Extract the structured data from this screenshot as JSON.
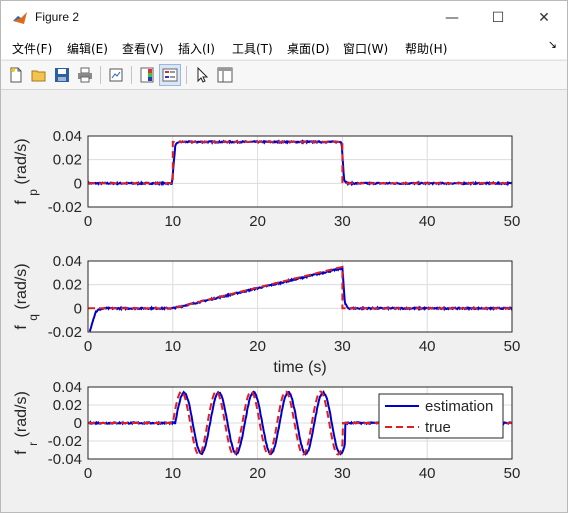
{
  "window": {
    "title": "Figure 2",
    "minimize_glyph": "—",
    "maximize_glyph": "☐",
    "close_glyph": "✕"
  },
  "menu": {
    "items": [
      "文件(F)",
      "编辑(E)",
      "查看(V)",
      "插入(I)",
      "工具(T)",
      "桌面(D)",
      "窗口(W)",
      "帮助(H)"
    ],
    "overflow_glyph": "↘"
  },
  "toolbar": {
    "icons": [
      "new-figure-icon",
      "open-file-icon",
      "save-icon",
      "print-icon",
      "link-plot-icon",
      "insert-colorbar-icon",
      "insert-legend-icon",
      "edit-plot-icon",
      "property-inspector-icon"
    ]
  },
  "colors": {
    "estimation": "#0000cc",
    "true": "#e02020",
    "axes_bg": "#ffffff",
    "grid": "#dcdcdc"
  },
  "chart_data": [
    {
      "type": "line",
      "ylabel_main": "f",
      "ylabel_sub": "p",
      "ylabel_unit": "(rad/s)",
      "xlabel": "",
      "xlim": [
        0,
        50
      ],
      "ylim": [
        -0.02,
        0.04
      ],
      "xticks": [
        "0",
        "10",
        "20",
        "30",
        "40",
        "50"
      ],
      "yticks": [
        "0.04",
        "0.02",
        "0",
        "-0.02"
      ],
      "grid": true,
      "series": [
        {
          "name": "estimation",
          "style": "solid",
          "x": [
            0,
            9.9,
            10.3,
            10.7,
            29.9,
            30.2,
            30.6,
            50
          ],
          "y": [
            0,
            0,
            0.032,
            0.035,
            0.035,
            0.003,
            0,
            0
          ]
        },
        {
          "name": "true",
          "style": "dashed",
          "x": [
            0,
            10,
            10,
            30,
            30,
            50
          ],
          "y": [
            0,
            0,
            0.035,
            0.035,
            0,
            0
          ]
        }
      ]
    },
    {
      "type": "line",
      "ylabel_main": "f",
      "ylabel_sub": "q",
      "ylabel_unit": "(rad/s)",
      "xlabel": "time (s)",
      "xlim": [
        0,
        50
      ],
      "ylim": [
        -0.02,
        0.04
      ],
      "xticks": [
        "0",
        "10",
        "20",
        "30",
        "40",
        "50"
      ],
      "yticks": [
        "0.04",
        "0.02",
        "0",
        "-0.02"
      ],
      "grid": true,
      "series": [
        {
          "name": "estimation",
          "style": "solid",
          "x": [
            0.2,
            0.5,
            0.9,
            1.3,
            2,
            10,
            30,
            30.3,
            30.7,
            50
          ],
          "y": [
            -0.02,
            -0.012,
            -0.003,
            -0.001,
            0,
            0,
            0.034,
            0.004,
            0,
            0
          ]
        },
        {
          "name": "true",
          "style": "dashed",
          "x": [
            0,
            10,
            30,
            30,
            50
          ],
          "y": [
            0,
            0,
            0.035,
            0,
            0
          ]
        }
      ]
    },
    {
      "type": "line",
      "ylabel_main": "f",
      "ylabel_sub": "r",
      "ylabel_unit": "(rad/s)",
      "xlabel": "",
      "xlim": [
        0,
        50
      ],
      "ylim": [
        -0.04,
        0.04
      ],
      "xticks": [
        "0",
        "10",
        "20",
        "30",
        "40",
        "50"
      ],
      "yticks": [
        "0.04",
        "0.02",
        "0",
        "-0.02",
        "-0.04"
      ],
      "grid": true,
      "legend": {
        "placement": "top-right",
        "entries": [
          "estimation",
          "true"
        ]
      },
      "series": [
        {
          "name": "estimation",
          "style": "solid",
          "sine": {
            "start": 10,
            "end": 30,
            "amplitude": 0.034,
            "period": 4.1,
            "delay": 0.3
          }
        },
        {
          "name": "true",
          "style": "dashed",
          "sine": {
            "start": 10,
            "end": 30,
            "amplitude": 0.035,
            "period": 4.1,
            "delay": 0
          }
        }
      ]
    }
  ]
}
